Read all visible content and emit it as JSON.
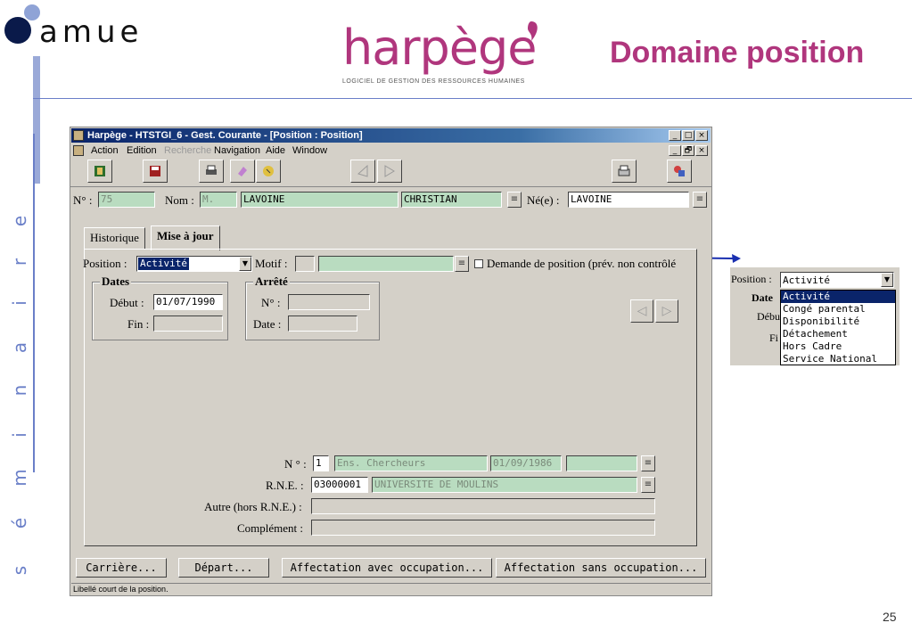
{
  "slide": {
    "logo_text": "amue",
    "side_word": [
      "s",
      "é",
      "m",
      "i",
      "n",
      "a",
      "i",
      "r",
      "e"
    ],
    "brand_name": "harpège",
    "brand_subtitle": "LOGICIEL DE GESTION DES RESSOURCES HUMAINES",
    "title": "Domaine position",
    "page_number": "25",
    "colors": {
      "accent": "#b0367d",
      "rule": "#6a7fc8"
    }
  },
  "window": {
    "title": "Harpège - HTSTGI_6 - Gest. Courante - [Position : Position]",
    "buttons": {
      "minimize": "_",
      "maximize": "□",
      "close": "×",
      "restore": "🗗"
    },
    "menu": [
      "Action",
      "Edition",
      "Recherche",
      "Navigation",
      "Aide",
      "Window"
    ],
    "menu_disabled": [
      "Recherche"
    ],
    "toolbar_icons": [
      "exit-icon",
      "save-icon",
      "print-icon",
      "eraser-icon",
      "help-icon",
      "prev-record-icon",
      "next-record-icon",
      "printer-icon",
      "tools-icon"
    ]
  },
  "header": {
    "num_label": "N° :",
    "num_value": "75",
    "nom_label": "Nom :",
    "civ_value": "M.",
    "nom_value": "LAVOINE",
    "prenom_value": "CHRISTIAN",
    "nee_label": "Né(e) :",
    "nee_value": "LAVOINE"
  },
  "tabs": [
    "Historique",
    "Mise à jour"
  ],
  "form": {
    "position_label": "Position :",
    "position_value": "Activité",
    "motif_label": "Motif :",
    "demande_label": "Demande de position (prév. non contrôlé",
    "dates_title": "Dates",
    "debut_label": "Début :",
    "debut_value": "01/07/1990",
    "fin_label": "Fin :",
    "arrete_title": "Arrêté",
    "arrete_num_label": "N° :",
    "arrete_date_label": "Date :",
    "affect_num_label": "N ° :",
    "affect_num_value": "1",
    "affect_type_value": "Ens. Chercheurs",
    "affect_date_value": "01/09/1986",
    "rne_label": "R.N.E. :",
    "rne_code": "03000001",
    "rne_name": "UNIVERSITE DE MOULINS",
    "autre_label": "Autre (hors R.N.E.) :",
    "complement_label": "Complément :"
  },
  "buttons": [
    "Carrière...",
    "Départ...",
    "Affectation avec occupation...",
    "Affectation sans occupation..."
  ],
  "status": "Libellé court de la position.",
  "inset": {
    "position_label": "Position :",
    "selected": "Activité",
    "dates_label": "Date",
    "debut_label": "Débu",
    "fin_label": "Fi",
    "options": [
      "Activité",
      "Congé parental",
      "Disponibilité",
      "Détachement",
      "Hors Cadre",
      "Service National"
    ]
  }
}
